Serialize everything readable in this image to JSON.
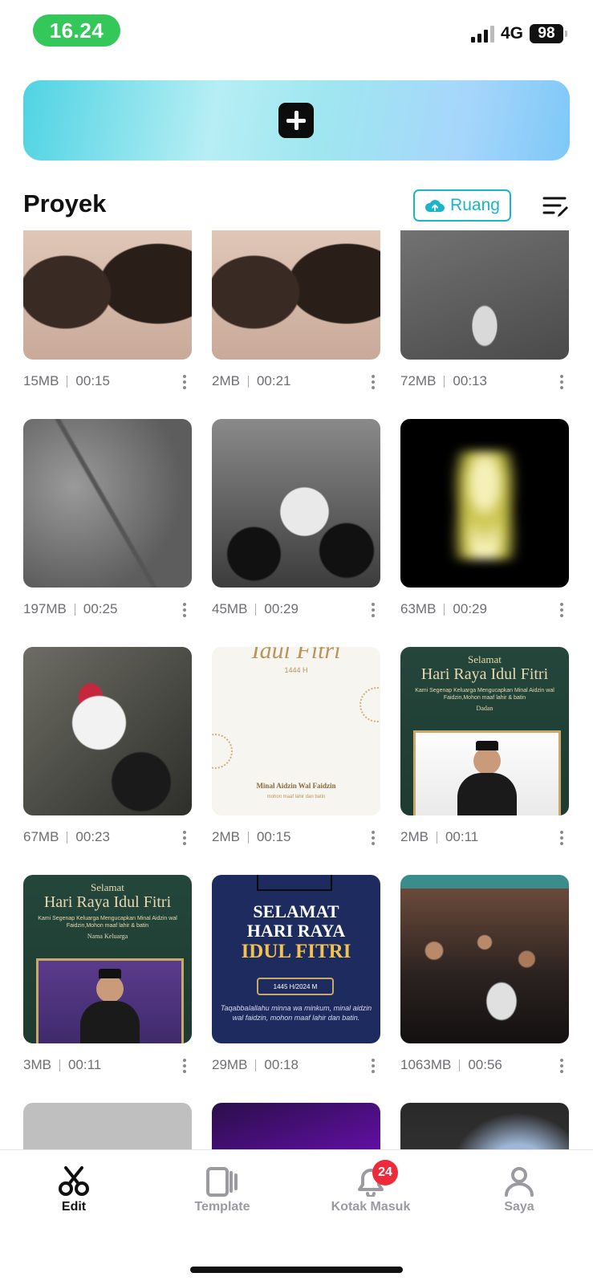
{
  "status": {
    "time": "16.24",
    "network": "4G",
    "battery": "98"
  },
  "header": {
    "section_title": "Proyek",
    "ruang_label": "Ruang"
  },
  "projects": [
    {
      "size": "15MB",
      "duration": "00:15"
    },
    {
      "size": "2MB",
      "duration": "00:21"
    },
    {
      "size": "72MB",
      "duration": "00:13"
    },
    {
      "size": "197MB",
      "duration": "00:25"
    },
    {
      "size": "45MB",
      "duration": "00:29"
    },
    {
      "size": "63MB",
      "duration": "00:29"
    },
    {
      "size": "67MB",
      "duration": "00:23"
    },
    {
      "size": "2MB",
      "duration": "00:15"
    },
    {
      "size": "2MB",
      "duration": "00:11"
    },
    {
      "size": "3MB",
      "duration": "00:11"
    },
    {
      "size": "29MB",
      "duration": "00:18"
    },
    {
      "size": "1063MB",
      "duration": "00:56"
    },
    {
      "size": "",
      "duration": ""
    },
    {
      "size": "",
      "duration": ""
    },
    {
      "size": "",
      "duration": ""
    }
  ],
  "thumb_text": {
    "card8": {
      "script": "Idul Fitri",
      "year": "1444 H",
      "line1": "Minal Aidzin Wal Faidzin",
      "line2": "mohon maaf lahir dan batin"
    },
    "card9": {
      "top": "Selamat",
      "title": "Hari Raya Idul Fitri",
      "sub": "Kami Segenap Keluarga Mengucapkan Minal Aidzin wal Faidzin,Mohon maaf lahir & batin",
      "name": "Dadan"
    },
    "card10": {
      "top": "Selamat",
      "title": "Hari Raya Idul Fitri",
      "sub": "Kami Segenap Keluarga Mengucapkan Minal Aidzin wal Faidzin,Mohon maaf lahir & batin",
      "name": "Nama Keluarga"
    },
    "card11": {
      "line1": "SELAMAT",
      "line2": "HARI RAYA",
      "line3": "IDUL FITRI",
      "badge": "1445 H/2024 M",
      "line4": "Taqabbalallahu minna wa minkum, minal aidzin wal faidzin, mohon maaf lahir dan batin."
    }
  },
  "nav": [
    {
      "label": "Edit",
      "icon": "scissors-icon",
      "active": true
    },
    {
      "label": "Template",
      "icon": "template-icon",
      "active": false
    },
    {
      "label": "Kotak Masuk",
      "icon": "bell-icon",
      "active": false,
      "badge": "24"
    },
    {
      "label": "Saya",
      "icon": "profile-icon",
      "active": false
    }
  ],
  "colors": {
    "accent": "#1bb5c9",
    "status_green": "#34c759",
    "badge_red": "#ef2b3b"
  }
}
